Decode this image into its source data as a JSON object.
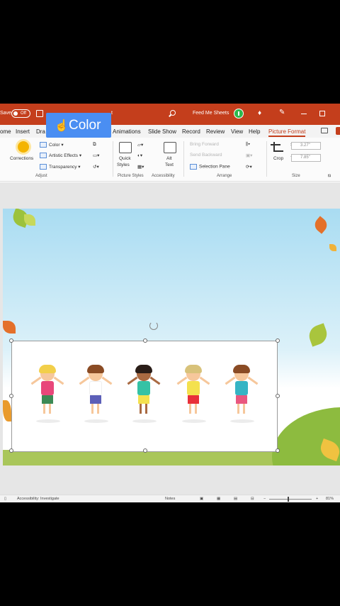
{
  "titlebar": {
    "autosave_label": "Save",
    "autosave_state": "Off",
    "file_name_tail": "t",
    "user_name": "Feed Me Sheets"
  },
  "tooltip": {
    "label": "Color",
    "icon": "pointing-hand-icon"
  },
  "tabs": [
    {
      "label": "ome",
      "active": false
    },
    {
      "label": "Insert",
      "active": false
    },
    {
      "label": "Dra",
      "active": false
    },
    {
      "label": "Animations",
      "active": false
    },
    {
      "label": "Slide Show",
      "active": false
    },
    {
      "label": "Record",
      "active": false
    },
    {
      "label": "Review",
      "active": false
    },
    {
      "label": "View",
      "active": false
    },
    {
      "label": "Help",
      "active": false
    },
    {
      "label": "Picture Format",
      "active": true
    }
  ],
  "ribbon": {
    "adjust": {
      "corrections": "Corrections",
      "color": "Color",
      "artistic_effects": "Artistic Effects",
      "transparency": "Transparency",
      "group_label": "Adjust"
    },
    "picture_styles": {
      "quick_styles_line1": "Quick",
      "quick_styles_line2": "Styles",
      "group_label": "Picture Styles"
    },
    "accessibility": {
      "alt_text_line1": "Alt",
      "alt_text_line2": "Text",
      "group_label": "Accessibility"
    },
    "arrange": {
      "bring_forward": "Bring Forward",
      "send_backward": "Send Backward",
      "selection_pane": "Selection Pane",
      "group_label": "Arrange"
    },
    "size": {
      "crop": "Crop",
      "height": "3.27\"",
      "width": "7.85\"",
      "group_label": "Size"
    }
  },
  "status": {
    "accessibility": "Accessibility: Investigate",
    "notes": "Notes",
    "zoom": "81%"
  },
  "colors": {
    "brand": "#c43e1c",
    "tooltip": "#4a8ef2",
    "sky": "#a9dcf2",
    "grass": "#8dbb3f"
  }
}
